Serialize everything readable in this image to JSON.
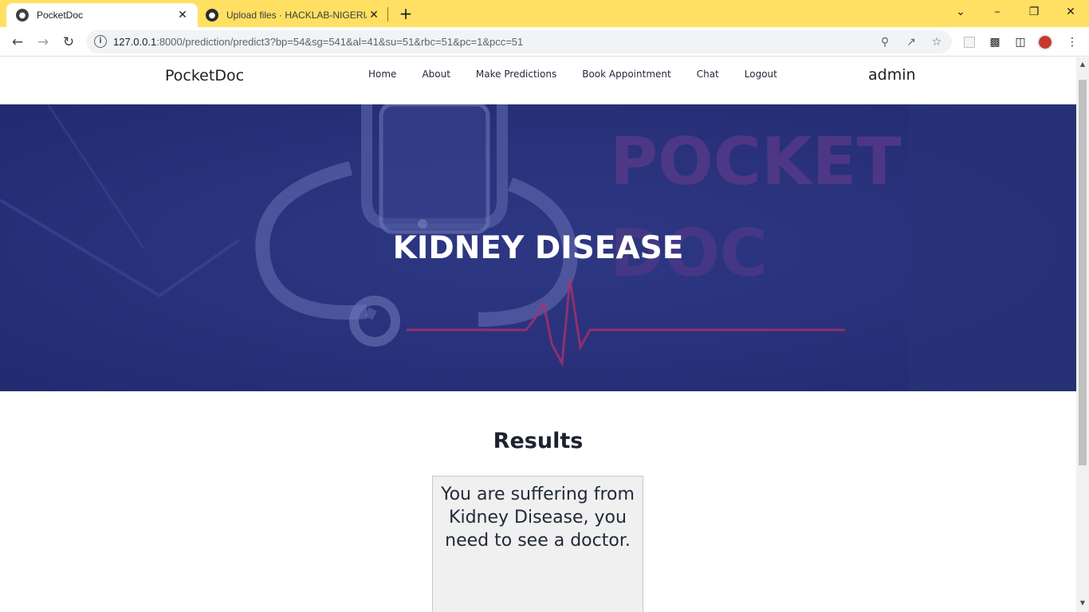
{
  "browser": {
    "tabs": [
      {
        "title": "PocketDoc",
        "active": true,
        "icon": "globe-icon"
      },
      {
        "title": "Upload files · HACKLAB-NIGERIA",
        "active": false,
        "icon": "github-icon"
      }
    ],
    "address": {
      "host": "127.0.0.1",
      "path": ":8000/prediction/predict3?bp=54&sg=541&al=41&su=51&rbc=51&pc=1&pcc=51"
    },
    "accent_color": "#ffe063"
  },
  "site": {
    "brand": "PocketDoc",
    "nav": [
      "Home",
      "About",
      "Make Predictions",
      "Book Appointment",
      "Chat",
      "Logout"
    ],
    "user": "admin"
  },
  "hero": {
    "title": "KIDNEY DISEASE",
    "background_color": "#27307a",
    "watermark_lines": [
      "POCKET",
      "DOC"
    ]
  },
  "results": {
    "heading": "Results",
    "message": "You are suffering from Kidney Disease, you need to see a doctor."
  }
}
